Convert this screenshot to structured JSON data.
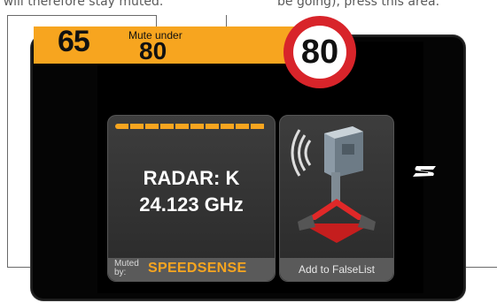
{
  "captions": {
    "left": "rt will therefore stay muted.",
    "right": "be going), press this area."
  },
  "speed_bar": {
    "current_speed": "65",
    "mute_label": "Mute under",
    "mute_threshold": "80",
    "speed_limit": "80"
  },
  "radar_panel": {
    "band": "RADAR: K",
    "frequency": "24.123 GHz",
    "muted_label": "Muted by:",
    "muted_source": "SPEEDSENSE",
    "signal_strength": 1.0
  },
  "false_list_panel": {
    "label": "Add to FalseList",
    "icon": "radar-camera-icon"
  },
  "brand_logo": "speedsense-logo-icon",
  "colors": {
    "accent": "#f7a51f",
    "sign_red": "#d8242a",
    "screen": "#000000",
    "panel": "#3a3a3a"
  }
}
